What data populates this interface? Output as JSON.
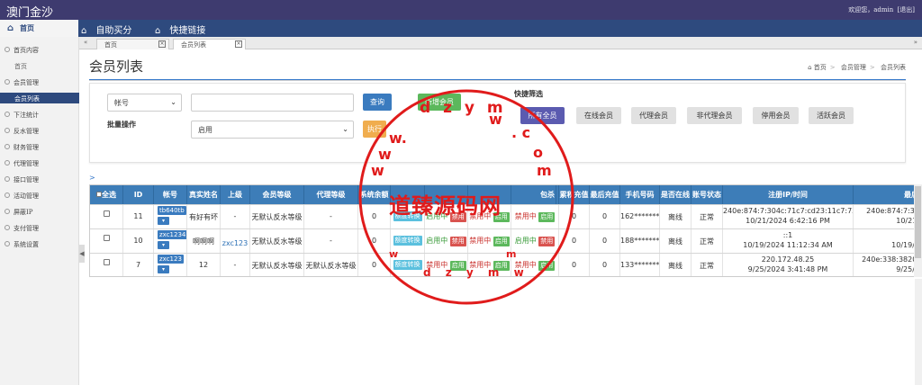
{
  "topbar": {
    "brand": "澳门金沙",
    "welcome": "欢迎您，admin",
    "logout": "[退出]"
  },
  "menubar": {
    "home": "首页",
    "items": [
      "自助买分",
      "快捷链接"
    ]
  },
  "sidebar": {
    "items": [
      "首页内容",
      "会员管理",
      "下注统计",
      "反水管理",
      "财务管理",
      "代理管理",
      "接口管理",
      "活动管理",
      "屏蔽IP",
      "支付管理",
      "系统设置"
    ],
    "sub_home": "首页",
    "sub_member": "会员列表"
  },
  "tabs": [
    {
      "label": "首页"
    },
    {
      "label": "会员列表"
    }
  ],
  "page": {
    "title": "会员列表",
    "breadcrumb": [
      "首页",
      "会员管理",
      "会员列表"
    ]
  },
  "filter": {
    "field_select": "帐号",
    "search_value": "",
    "query_btn": "查询",
    "add_btn": "新增会员",
    "bulk_label": "批量操作",
    "bulk_select": "启用",
    "exec_btn": "执行",
    "quick_label": "快捷筛选",
    "quick_buttons": [
      "所有全员",
      "在线会员",
      "代理会员",
      "非代理会员",
      "停用会员",
      "活跃会员"
    ]
  },
  "table": {
    "headers": [
      "全选",
      "ID",
      "帐号",
      "真实姓名",
      "上级",
      "会员等级",
      "代理等级",
      "系统余额",
      "",
      "",
      "",
      "",
      "包杀",
      "累积充值",
      "最后充值",
      "手机号码",
      "是否在线",
      "账号状态",
      "注册IP/时间",
      "最后"
    ],
    "rows": [
      {
        "id": "11",
        "account": "tb640tb",
        "name": "有好有坏",
        "parent": "-",
        "level": "无默认反水等级",
        "agent": "-",
        "balance": "0",
        "total": "0",
        "last": "0",
        "phone": "162********",
        "online": "离线",
        "status": "正常",
        "reg_ip": "240e:874:7:304c:71c7:cd23:11c7:7339",
        "reg_time": "10/21/2024 6:42:16 PM",
        "last_ip": "240e:874:7:30",
        "last_time": "10/21/"
      },
      {
        "id": "10",
        "account": "zxc1234",
        "name": "啊啊啊",
        "parent": "zxc123",
        "level": "无默认反水等级",
        "agent": "-",
        "balance": "0",
        "total": "0",
        "last": "0",
        "phone": "188********",
        "online": "离线",
        "status": "正常",
        "reg_ip": "::1",
        "reg_time": "10/19/2024 11:12:34 AM",
        "last_ip": "",
        "last_time": "10/19/2"
      },
      {
        "id": "7",
        "account": "zxc123",
        "name": "12",
        "parent": "-",
        "level": "无默认反水等级",
        "agent": "无默认反水等级",
        "balance": "0",
        "total": "0",
        "last": "0",
        "phone": "133********",
        "online": "离线",
        "status": "正常",
        "reg_ip": "220.172.48.25",
        "reg_time": "9/25/2024 3:41:48 PM",
        "last_ip": "240e:338:3820:",
        "last_time": "9/25/2"
      }
    ],
    "tags": {
      "convert": "额度转换",
      "enabled_state": "启用中",
      "disable": "禁用",
      "disabled_state": "禁用中",
      "enable": "启用"
    }
  },
  "watermark": {
    "text": "道臻源码网",
    "url": "www.dzym.com"
  },
  "colors": {
    "topbar": "#3e3b6f",
    "menubar": "#2e4a7e",
    "table_header": "#3d7db8",
    "watermark": "#e01b1b"
  }
}
